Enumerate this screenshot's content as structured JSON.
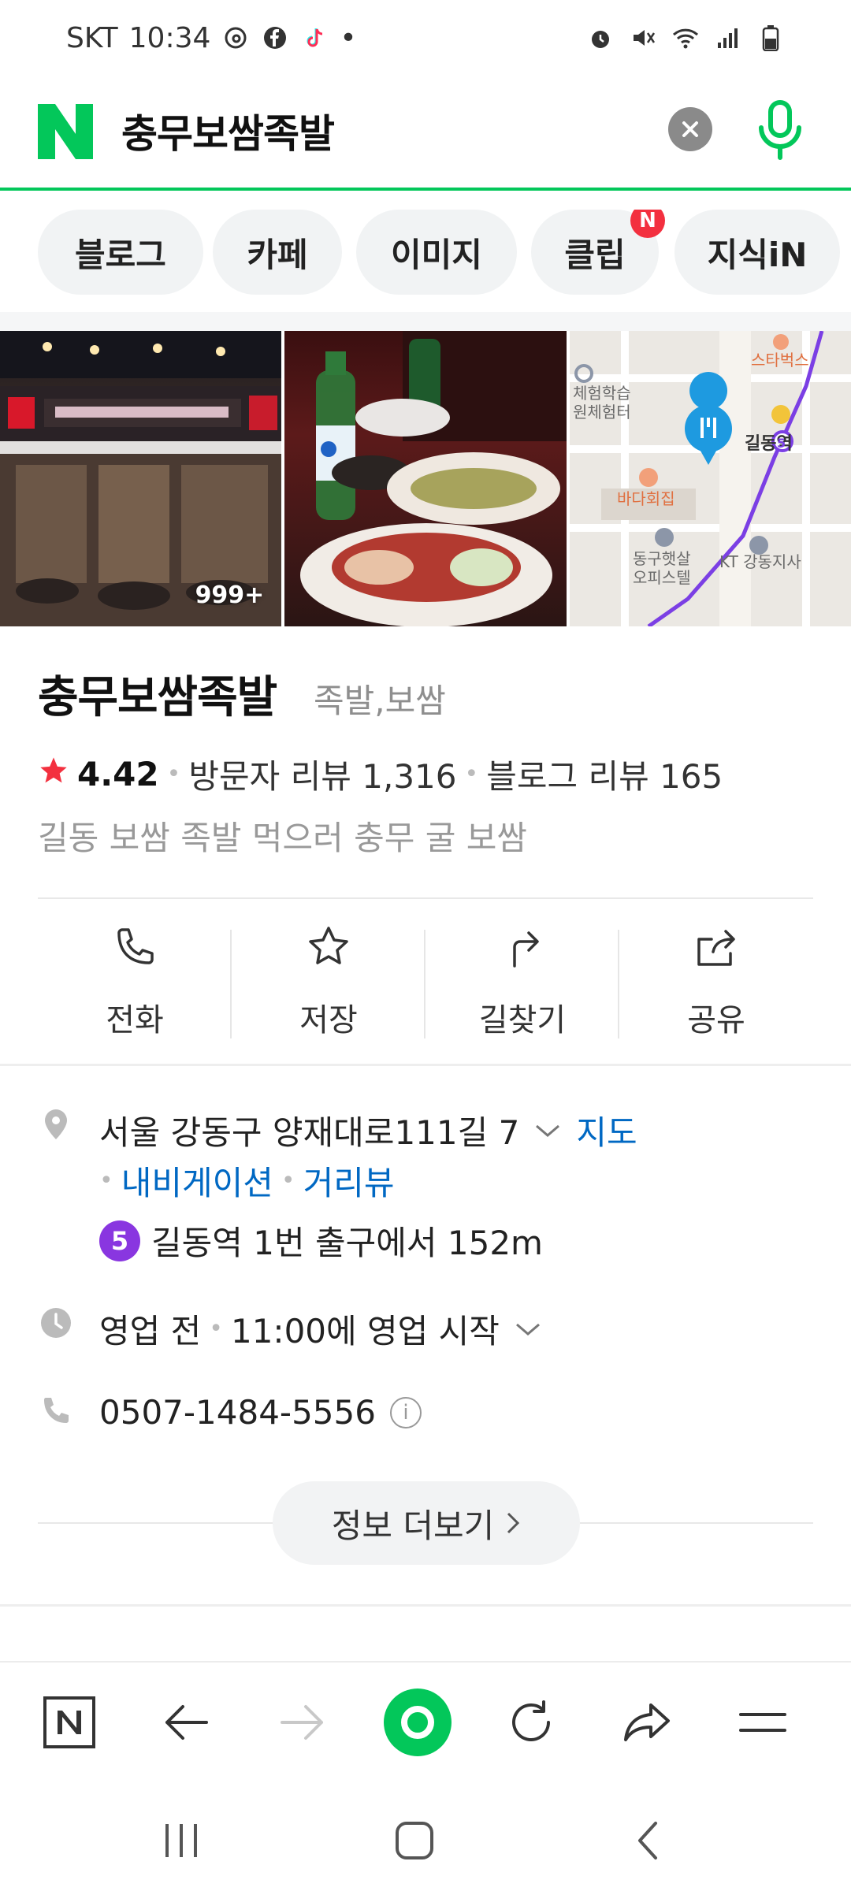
{
  "status_bar": {
    "carrier": "SKT",
    "time": "10:34",
    "app_icons": [
      "threads-icon",
      "facebook-icon",
      "tiktok-icon"
    ],
    "dot": "•"
  },
  "search": {
    "query": "충무보쌈족발",
    "brand_color": "#03c75a"
  },
  "tabs": [
    {
      "label": "블로그"
    },
    {
      "label": "카페"
    },
    {
      "label": "이미지"
    },
    {
      "label": "클립",
      "badge": "N"
    },
    {
      "label": "지식iN"
    }
  ],
  "photos": {
    "count_label": "999+",
    "map": {
      "labels": [
        "스타벅스",
        "체험학습",
        "원체험터",
        "길동역",
        "바다회집",
        "동구햇살",
        "오피스텔",
        "KT 강동지사"
      ],
      "subway_number": "5"
    }
  },
  "place": {
    "name": "충무보쌈족발",
    "category": "족발,보쌈",
    "rating": "4.42",
    "visitor_reviews": "방문자 리뷰 1,316",
    "blog_reviews": "블로그 리뷰 165",
    "tagline": "길동 보쌈 족발 먹으러 충무 굴 보쌈"
  },
  "actions": [
    {
      "label": "전화",
      "icon": "phone-icon"
    },
    {
      "label": "저장",
      "icon": "star-icon"
    },
    {
      "label": "길찾기",
      "icon": "directions-icon"
    },
    {
      "label": "공유",
      "icon": "share-icon"
    }
  ],
  "details": {
    "address": "서울 강동구 양재대로111길 7",
    "map_link": "지도",
    "navigation_link": "내비게이션",
    "street_view_link": "거리뷰",
    "subway_line": "5",
    "subway_text": "길동역 1번 출구에서 152m",
    "hours_status": "영업 전",
    "hours_text": "11:00에 영업 시작",
    "phone": "0507-1484-5556",
    "info_glyph": "i"
  },
  "more_button": "정보 더보기",
  "colors": {
    "link": "#0068c3",
    "star": "#f3303f",
    "subway5": "#8936e0"
  }
}
